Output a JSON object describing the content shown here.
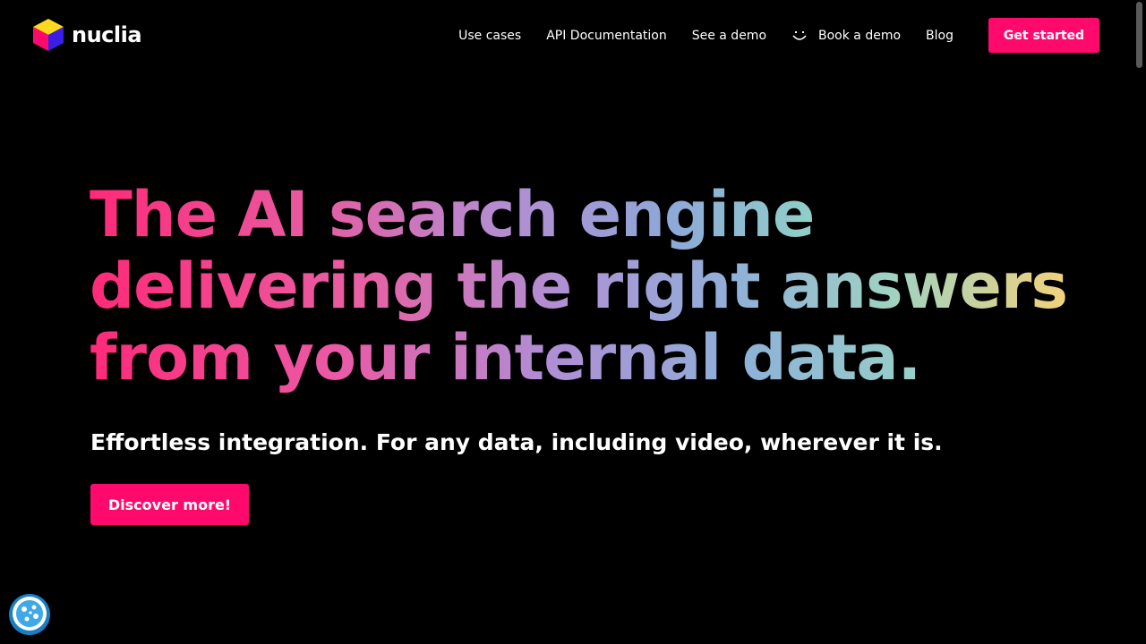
{
  "brand": {
    "name": "nuclia",
    "accent_color": "#ff0a6c",
    "logo_icon": "cube-logo-icon"
  },
  "nav": {
    "items": [
      {
        "label": "Use cases"
      },
      {
        "label": "API Documentation"
      },
      {
        "label": "See a demo"
      },
      {
        "label": "Book a demo",
        "icon": "smile-icon"
      },
      {
        "label": "Blog"
      }
    ],
    "cta_label": "Get started"
  },
  "hero": {
    "title_lines": [
      "The AI search engine",
      "delivering the right answers",
      "from your internal data."
    ],
    "subtitle": "Effortless integration. For any data, including video, wherever it is.",
    "cta_label": "Discover more!"
  },
  "widgets": {
    "cookie_icon": "cookie-settings-icon"
  }
}
